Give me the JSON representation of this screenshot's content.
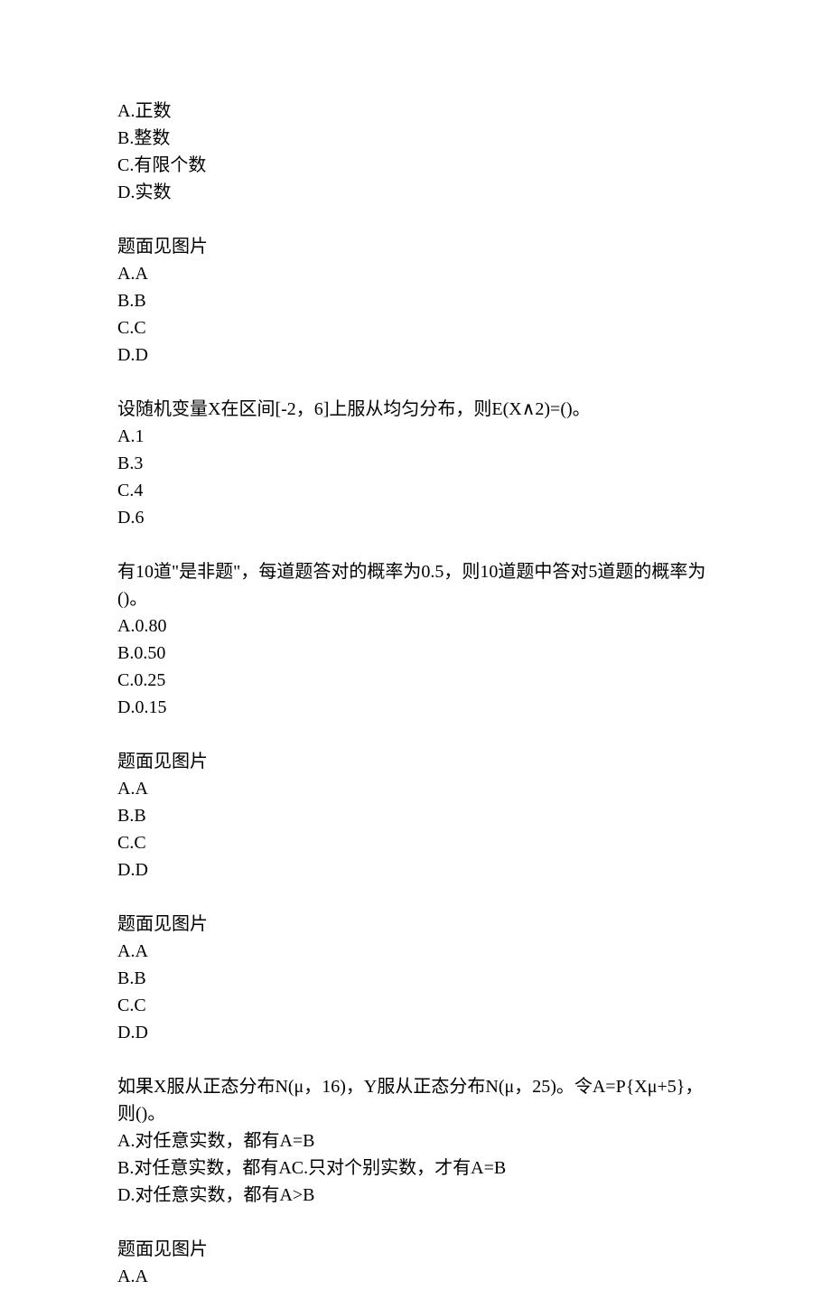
{
  "questions": [
    {
      "opts": [
        {
          "label": "A.",
          "text": "正数"
        },
        {
          "label": "B.",
          "text": "整数"
        },
        {
          "label": "C.",
          "text": "有限个数"
        },
        {
          "label": "D.",
          "text": "实数"
        }
      ]
    },
    {
      "stem": "题面见图片",
      "opts": [
        {
          "label": "A.",
          "text": "A"
        },
        {
          "label": "B.",
          "text": "B"
        },
        {
          "label": "C.",
          "text": "C"
        },
        {
          "label": "D.",
          "text": "D"
        }
      ]
    },
    {
      "stem": "设随机变量X在区间[-2，6]上服从均匀分布，则E(X∧2)=()。",
      "opts": [
        {
          "label": "A.",
          "text": "1"
        },
        {
          "label": "B.",
          "text": "3"
        },
        {
          "label": "C.",
          "text": "4"
        },
        {
          "label": "D.",
          "text": "6"
        }
      ]
    },
    {
      "stem": "有10道\"是非题\"，每道题答对的概率为0.5，则10道题中答对5道题的概率为()。",
      "opts": [
        {
          "label": "A.",
          "text": "0.80"
        },
        {
          "label": "B.",
          "text": "0.50"
        },
        {
          "label": "C.",
          "text": "0.25"
        },
        {
          "label": "D.",
          "text": "0.15"
        }
      ]
    },
    {
      "stem": "题面见图片",
      "opts": [
        {
          "label": "A.",
          "text": "A"
        },
        {
          "label": "B.",
          "text": "B"
        },
        {
          "label": "C.",
          "text": "C"
        },
        {
          "label": "D.",
          "text": "D"
        }
      ]
    },
    {
      "stem": "题面见图片",
      "opts": [
        {
          "label": "A.",
          "text": "A"
        },
        {
          "label": "B.",
          "text": "B"
        },
        {
          "label": "C.",
          "text": "C"
        },
        {
          "label": "D.",
          "text": "D"
        }
      ]
    },
    {
      "stem": "如果X服从正态分布N(μ，16)，Y服从正态分布N(μ，25)。令A=P{Xμ+5}，则()。",
      "opts": [
        {
          "label": "A.",
          "text": "对任意实数，都有A=B"
        },
        {
          "label": "B.",
          "text": "对任意实数，都有AC.只对个别实数，才有A=B"
        },
        {
          "label": "D.",
          "text": "对任意实数，都有A>B"
        }
      ]
    },
    {
      "stem": "题面见图片",
      "opts": [
        {
          "label": "A.",
          "text": "A"
        }
      ]
    }
  ]
}
